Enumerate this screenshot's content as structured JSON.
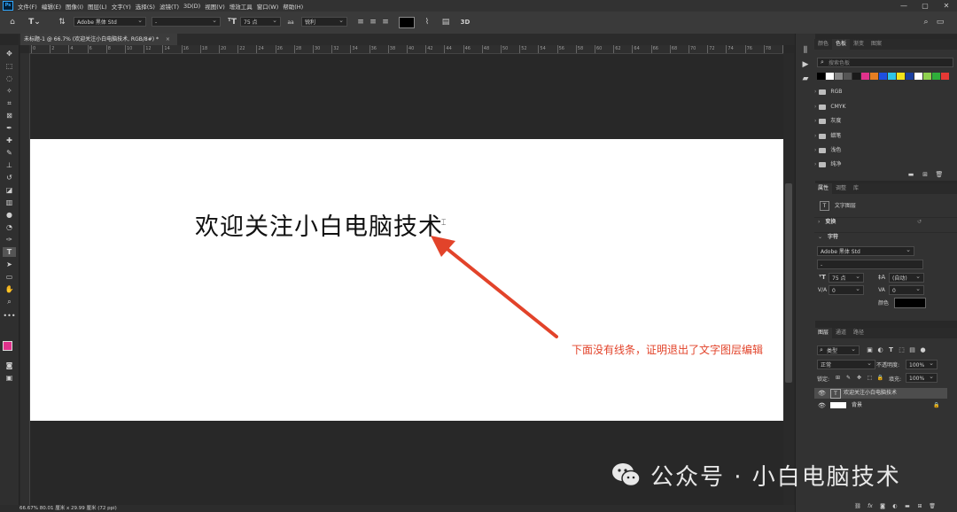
{
  "menubar": {
    "items": [
      "文件(F)",
      "编辑(E)",
      "图像(I)",
      "图层(L)",
      "文字(Y)",
      "选择(S)",
      "滤镜(T)",
      "3D(D)",
      "视图(V)",
      "增效工具",
      "窗口(W)",
      "帮助(H)"
    ]
  },
  "options": {
    "font_family": "Adobe 黑体 Std",
    "font_style": "-",
    "font_size": "75 点",
    "antialias_label": "aa",
    "antialias": "锐利",
    "threed": "3D",
    "text_color": "#000000"
  },
  "document": {
    "tab_title": "未标题-1 @ 66.7% (欢迎关注小白电脑技术, RGB/8#) *",
    "canvas_text": "欢迎关注小白电脑技术",
    "annotation": "下面没有线条，证明退出了文字图层编辑",
    "status": "66.67%  80.01 厘米 x 29.99 厘米 (72 ppi)"
  },
  "ruler": {
    "ticks": [
      "0",
      "2",
      "4",
      "6",
      "8",
      "10",
      "12",
      "14",
      "16",
      "18",
      "20",
      "22",
      "24",
      "26",
      "28",
      "30",
      "32",
      "34",
      "36",
      "38",
      "40",
      "42",
      "44",
      "46",
      "48",
      "50",
      "52",
      "54",
      "56",
      "58",
      "60",
      "62",
      "64",
      "66",
      "68",
      "70",
      "72",
      "74",
      "76",
      "78",
      "80"
    ]
  },
  "color_panel": {
    "tabs": [
      "颜色",
      "色板",
      "渐变",
      "图案"
    ],
    "active_tab": "色板",
    "search_placeholder": "搜索色板",
    "swatches": [
      "#000000",
      "#ffffff",
      "#888888",
      "#555555",
      "#1a1a1a",
      "#e0328c",
      "#e67e22",
      "#1e4fe0",
      "#2ec4e8",
      "#f1e21b",
      "#1b3fa0",
      "#ffffff",
      "#8fd14f",
      "#2fae3a",
      "#e53935"
    ],
    "groups": [
      "RGB",
      "CMYK",
      "灰度",
      "蜡笔",
      "浅色",
      "纯净"
    ]
  },
  "properties_panel": {
    "tabs": [
      "属性",
      "调整",
      "库"
    ],
    "active_tab": "属性",
    "layer_type": "文字图层",
    "transform_label": "变换",
    "character_label": "字符",
    "font_family": "Adobe 黑体 Std",
    "font_style": "-",
    "font_size": "75 点",
    "leading": "(自动)",
    "tracking_left": "0",
    "tracking_right": "0",
    "color_label": "颜色",
    "color": "#000000"
  },
  "layers_panel": {
    "tabs": [
      "图层",
      "通道",
      "路径"
    ],
    "active_tab": "图层",
    "filter_label": "类型",
    "blend_mode": "正常",
    "opacity_label": "不透明度:",
    "opacity": "100%",
    "lock_label": "锁定:",
    "fill_label": "填充:",
    "fill": "100%",
    "layers": [
      {
        "name": "欢迎关注小白电脑技术",
        "type": "text"
      },
      {
        "name": "背景",
        "type": "background"
      }
    ]
  },
  "watermark": {
    "text": "公众号 · 小白电脑技术"
  }
}
